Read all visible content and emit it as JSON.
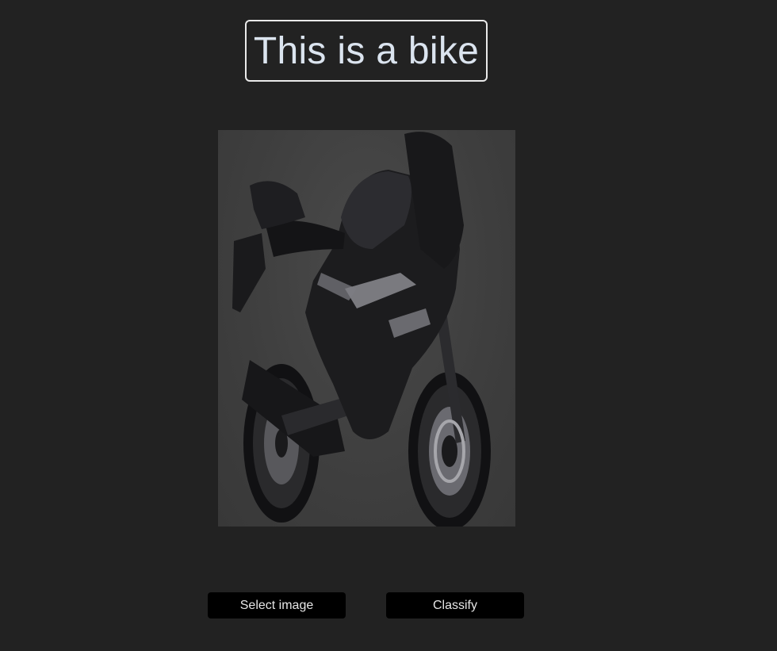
{
  "result": {
    "label": "This is a bike"
  },
  "preview": {
    "image": "motorcycle-photo",
    "colors": {
      "background": "#404040",
      "bike_body": "#1c1c1e",
      "trim": "#9a9aa0",
      "reflector": "#c0502a"
    }
  },
  "actions": {
    "select_label": "Select image",
    "classify_label": "Classify"
  },
  "colors": {
    "page_background": "#222222",
    "label_text": "#dbe4ef",
    "button_background": "#000000",
    "button_text": "#e6e6e6"
  }
}
